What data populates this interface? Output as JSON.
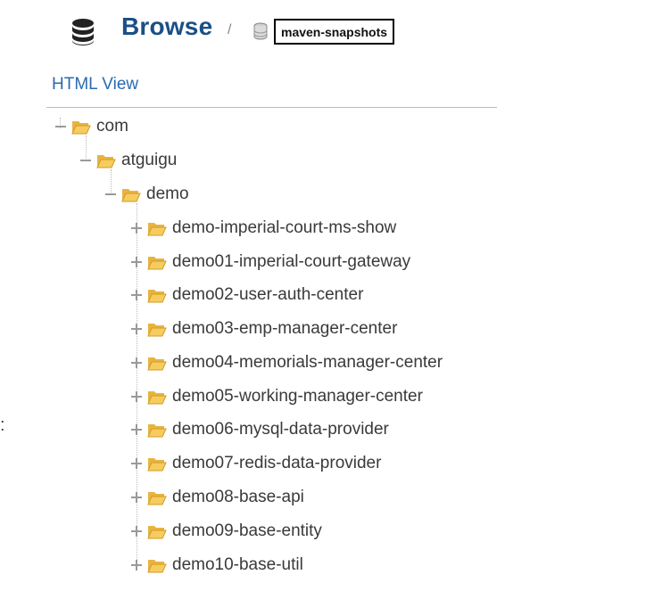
{
  "header": {
    "title": "Browse",
    "separator": "/",
    "repository": "maven-snapshots"
  },
  "view_link": "HTML View",
  "side_mark": ":",
  "tree": {
    "level0": "com",
    "level1": "atguigu",
    "level2": "demo",
    "children": [
      "demo-imperial-court-ms-show",
      "demo01-imperial-court-gateway",
      "demo02-user-auth-center",
      "demo03-emp-manager-center",
      "demo04-memorials-manager-center",
      "demo05-working-manager-center",
      "demo06-mysql-data-provider",
      "demo07-redis-data-provider",
      "demo08-base-api",
      "demo09-base-entity",
      "demo10-base-util"
    ]
  },
  "colors": {
    "title": "#1b4f86",
    "link": "#2a6ab0",
    "folder": "#f2c452"
  }
}
